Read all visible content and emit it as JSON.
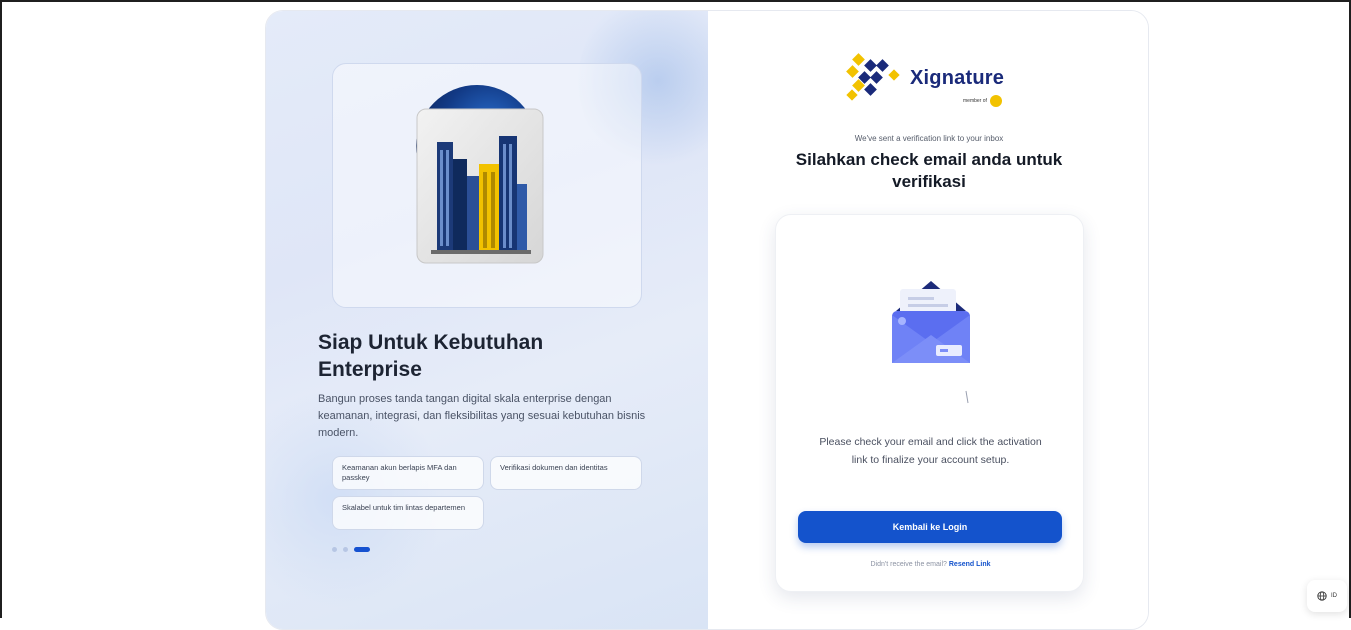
{
  "brand": {
    "name": "Xignature",
    "member_prefix": "member of",
    "colors": {
      "navy": "#1a2a7a",
      "gold": "#f2c200",
      "primary": "#1453cc"
    }
  },
  "carousel": {
    "illustration": "enterprise-buildings-icon",
    "title": "Siap Untuk Kebutuhan Enterprise",
    "description": "Bangun proses tanda tangan digital skala enterprise dengan keamanan, integrasi, dan fleksibilitas yang sesuai kebutuhan bisnis modern.",
    "features": [
      "Keamanan akun berlapis MFA dan passkey",
      "Verifikasi dokumen dan identitas",
      "Skalabel untuk tim lintas departemen"
    ],
    "slide_count": 3,
    "active_slide": 3
  },
  "verify": {
    "subtitle": "We've sent a verification link to your inbox",
    "title": "Silahkan check email anda untuk verifikasi",
    "illustration": "open-envelope-icon",
    "message": "Please check your email and click the activation link to finalize your account setup.",
    "button_label": "Kembali ke Login",
    "resend_prompt": "Didn't receive the email?",
    "resend_link": "Resend Link"
  },
  "language": {
    "code": "ID",
    "icon": "globe-icon"
  }
}
